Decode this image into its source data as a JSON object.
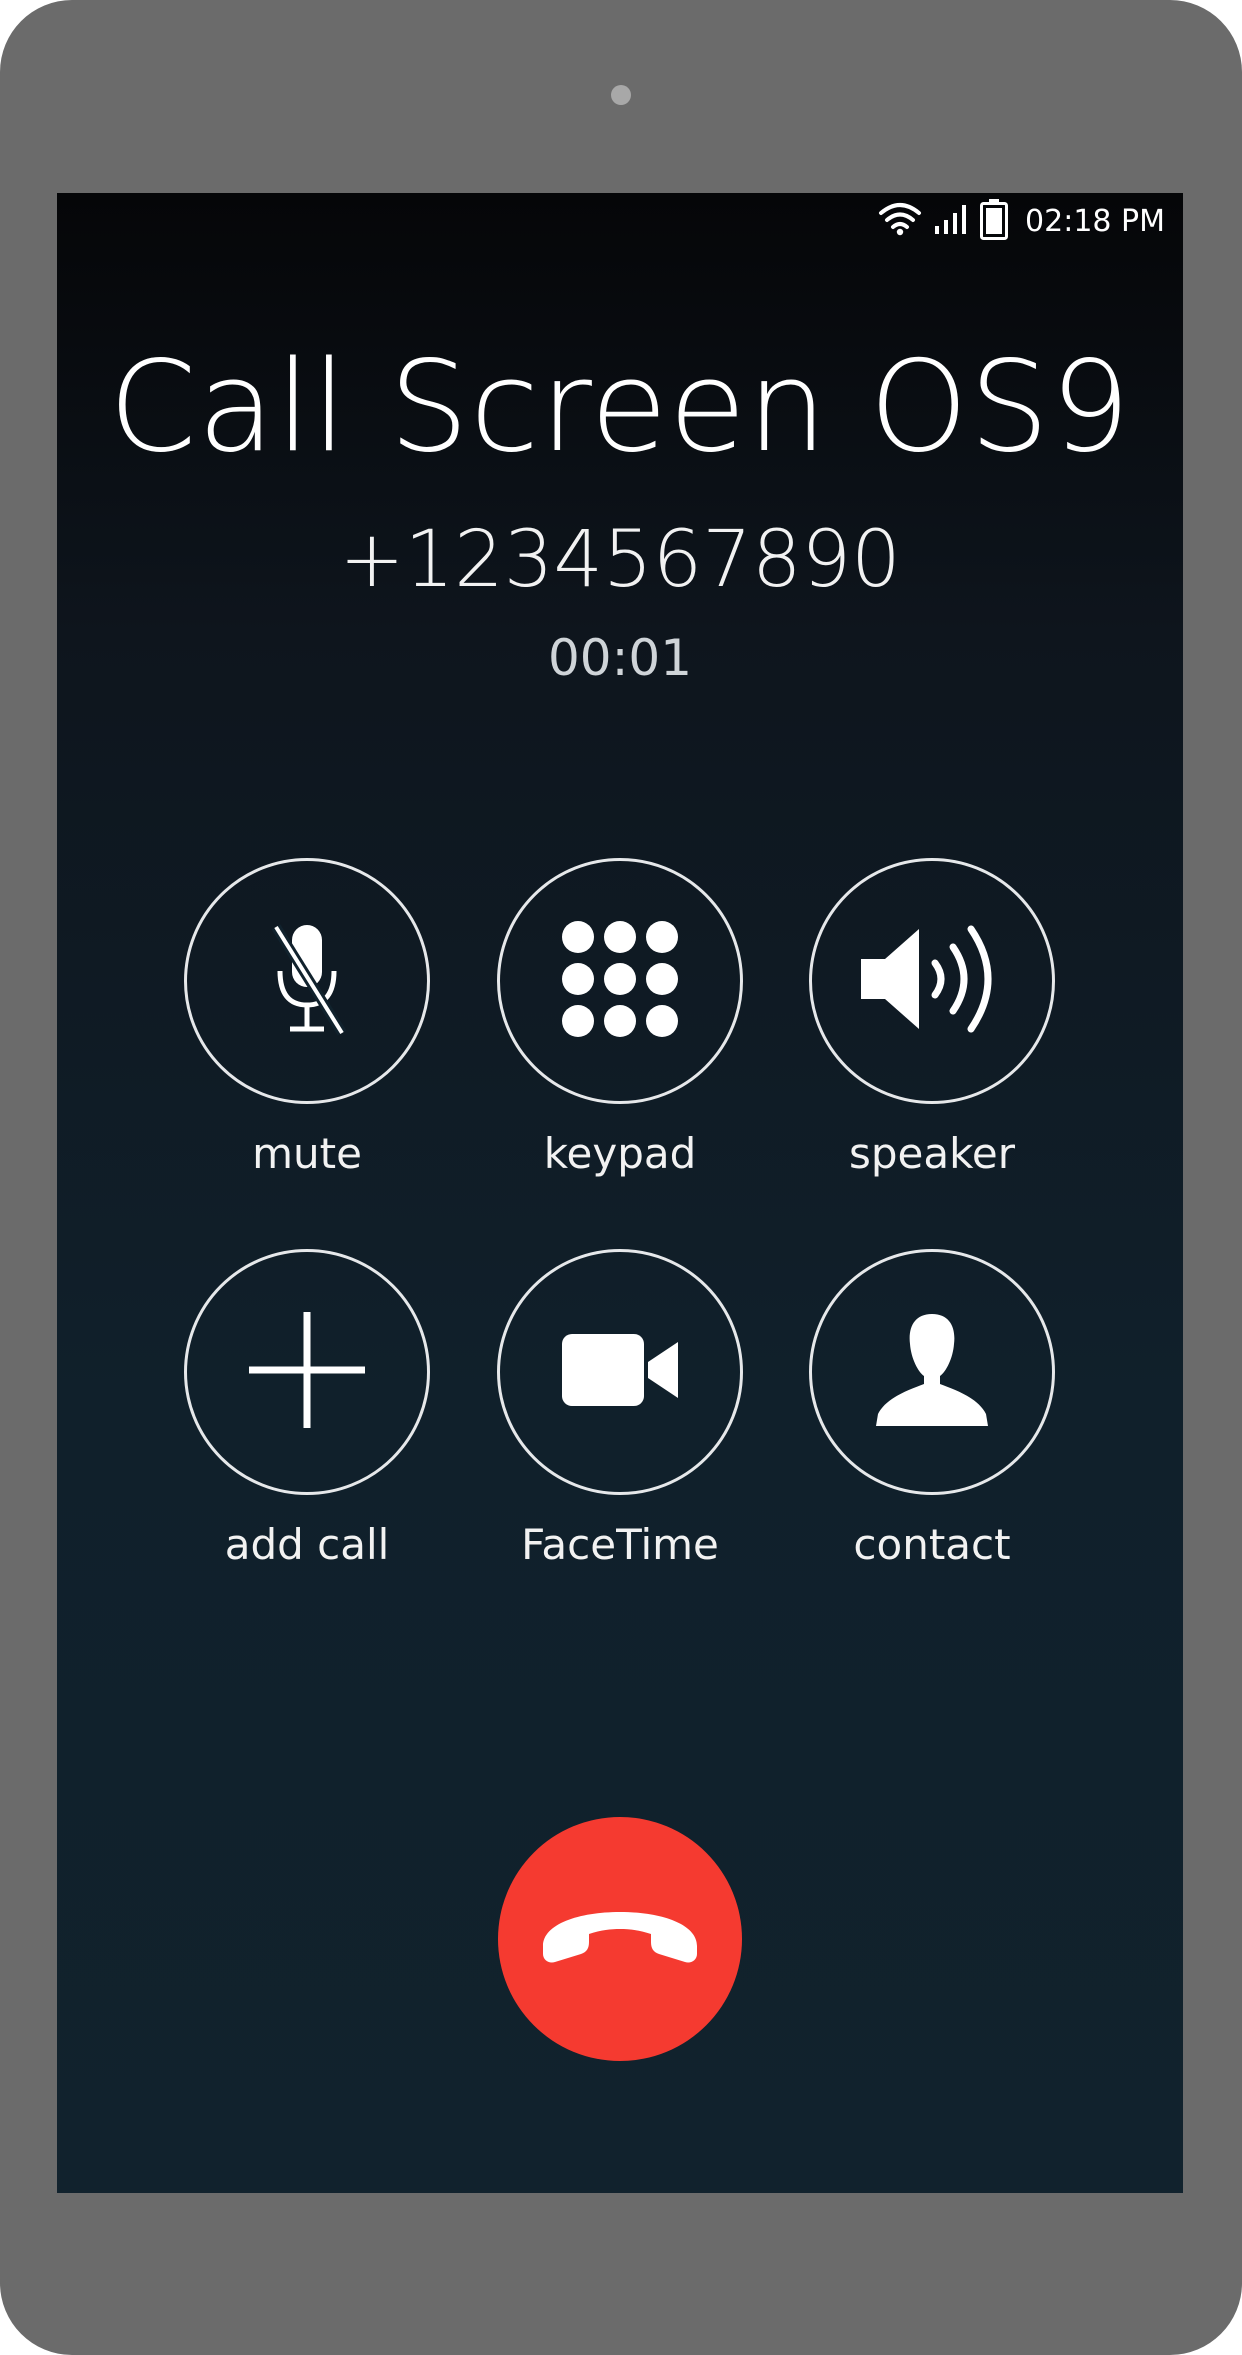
{
  "status_bar": {
    "time": "02:18 PM",
    "icons": [
      "wifi-icon",
      "signal-icon",
      "battery-icon"
    ]
  },
  "call": {
    "title": "Call Screen OS9",
    "number": "+1234567890",
    "duration": "00:01"
  },
  "actions": [
    {
      "label": "mute",
      "icon": "microphone-muted-icon"
    },
    {
      "label": "keypad",
      "icon": "keypad-icon"
    },
    {
      "label": "speaker",
      "icon": "speaker-icon"
    },
    {
      "label": "add call",
      "icon": "plus-icon"
    },
    {
      "label": "FaceTime",
      "icon": "video-camera-icon"
    },
    {
      "label": "contact",
      "icon": "person-icon"
    }
  ],
  "end_call": {
    "icon": "end-call-icon"
  },
  "colors": {
    "device_frame": "#6b6b6b",
    "screen_background": "#11222d",
    "end_call": "#f53a30",
    "text": "#ffffff"
  }
}
